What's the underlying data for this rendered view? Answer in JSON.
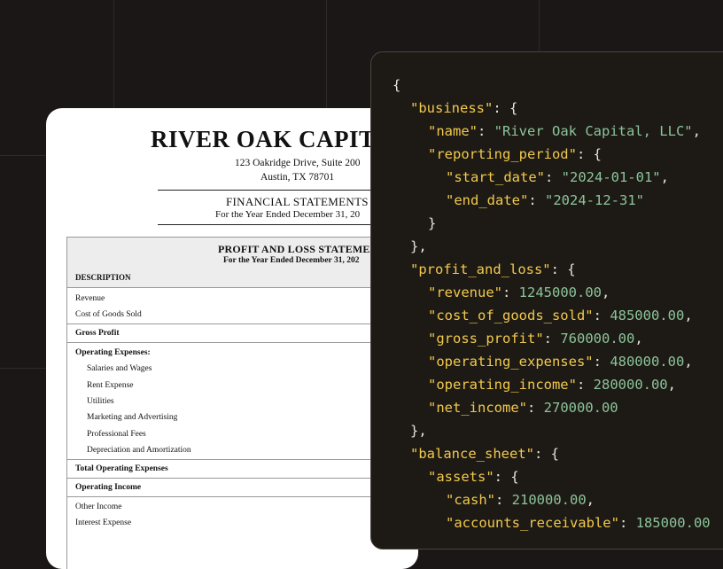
{
  "colors": {
    "background": "#1c1717",
    "code_key": "#f2c94c",
    "code_value": "#8cc49a",
    "code_punct": "#e8e3da"
  },
  "document": {
    "company_title": "RIVER OAK CAPITA",
    "address_line1": "123 Oakridge Drive, Suite 200",
    "address_line2": "Austin, TX 78701",
    "fs_title": "FINANCIAL STATEMENTS",
    "fs_subtitle": "For the Year Ended December 31, 20",
    "pl_title": "PROFIT AND LOSS STATEMEN",
    "pl_subtitle": "For the Year Ended December 31, 202",
    "column_header": "DESCRIPTION",
    "rows": {
      "revenue": "Revenue",
      "cogs": "Cost of Goods Sold",
      "gross_profit": "Gross Profit",
      "opex_heading": "Operating Expenses:",
      "salaries": "Salaries and Wages",
      "rent": "Rent Expense",
      "utilities": "Utilities",
      "marketing": "Marketing and Advertising",
      "professional_fees": "Professional Fees",
      "depreciation": "Depreciation and Amortization",
      "total_opex": "Total Operating Expenses",
      "operating_income": "Operating Income",
      "other_income": "Other Income",
      "interest_expense": "Interest Expense"
    }
  },
  "code": {
    "open_brace": "{",
    "business_key": "\"business\"",
    "name_key": "\"name\"",
    "name_val": "\"River Oak Capital, LLC\"",
    "reporting_period_key": "\"reporting_period\"",
    "start_date_key": "\"start_date\"",
    "start_date_val": "\"2024-01-01\"",
    "end_date_key": "\"end_date\"",
    "end_date_val": "\"2024-12-31\"",
    "close_inner": "}",
    "close_obj": "},",
    "pl_key": "\"profit_and_loss\"",
    "revenue_key": "\"revenue\"",
    "revenue_val": "1245000.00",
    "cogs_key": "\"cost_of_goods_sold\"",
    "cogs_val": "485000.00",
    "gross_profit_key": "\"gross_profit\"",
    "gross_profit_val": "760000.00",
    "opex_key": "\"operating_expenses\"",
    "opex_val": "480000.00",
    "opinc_key": "\"operating_income\"",
    "opinc_val": "280000.00",
    "net_income_key": "\"net_income\"",
    "net_income_val": "270000.00",
    "close_pl": "},",
    "bs_key": "\"balance_sheet\"",
    "assets_key": "\"assets\"",
    "cash_key": "\"cash\"",
    "cash_val": "210000.00",
    "ar_key": "\"accounts_receivable\"",
    "ar_val": "185000.00"
  }
}
